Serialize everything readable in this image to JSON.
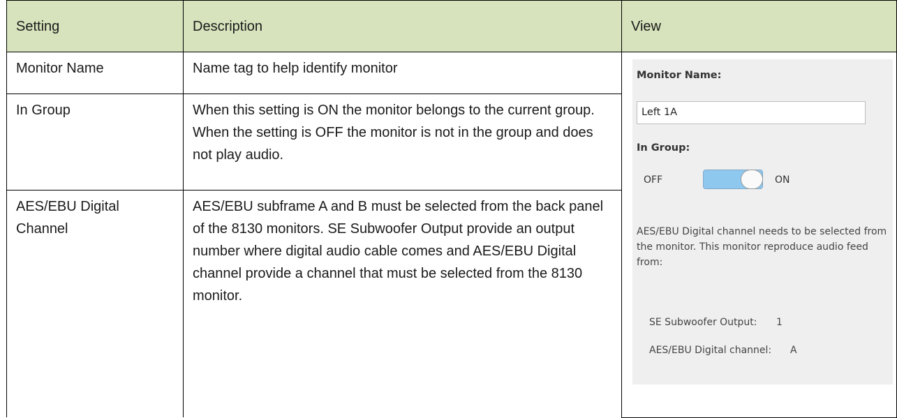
{
  "headers": {
    "setting": "Setting",
    "description": "Description",
    "view": "View"
  },
  "rows": [
    {
      "setting": "Monitor Name",
      "description": "Name tag to help identify monitor"
    },
    {
      "setting": "In Group",
      "description": "When this setting is ON the monitor belongs to the current group. When the setting is OFF the monitor is not in the group and does not play audio."
    },
    {
      "setting": "AES/EBU Digital Channel",
      "description": "AES/EBU subframe A and B must be selected from the back panel of the 8130 monitors. SE Subwoofer Output provide an output number where digital audio cable comes and AES/EBU Digital channel provide a channel that must be selected from the 8130 monitor."
    }
  ],
  "view_panel": {
    "monitor_name_label": "Monitor Name:",
    "monitor_name_value": "Left 1A",
    "in_group_label": "In Group:",
    "toggle_off_label": "OFF",
    "toggle_on_label": "ON",
    "toggle_state": "ON",
    "aes_description": "AES/EBU Digital channel needs to be selected from the monitor. This monitor reproduce audio feed from:",
    "se_output_label": "SE Subwoofer Output:",
    "se_output_value": "1",
    "aes_channel_label": "AES/EBU Digital channel:",
    "aes_channel_value": "A",
    "toggle_color": "#8ec8ee",
    "panel_bg": "#efefef"
  },
  "header_color": "#d6e3bc"
}
